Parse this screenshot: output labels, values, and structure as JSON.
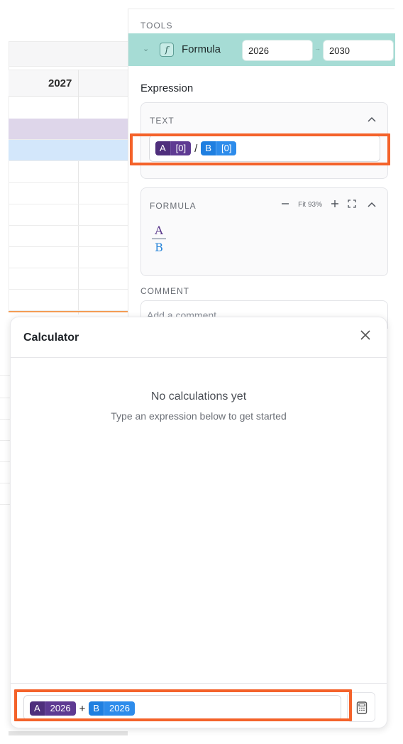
{
  "sheet": {
    "column_year": "2027"
  },
  "tools": {
    "section_title": "TOOLS",
    "formula_row": {
      "name": "Formula",
      "start_year": "2026",
      "end_year": "2030"
    },
    "expression_label": "Expression",
    "text_card": {
      "title": "TEXT",
      "tokens": {
        "a_letter": "A",
        "a_value": "[0]",
        "operator": "/",
        "b_letter": "B",
        "b_value": "[0]"
      }
    },
    "formula_card": {
      "title": "FORMULA",
      "fit_label": "Fit 93%",
      "numerator": "A",
      "denominator": "B"
    },
    "comment": {
      "title": "COMMENT",
      "placeholder": "Add a comment"
    }
  },
  "calculator": {
    "title": "Calculator",
    "empty_title": "No calculations yet",
    "empty_subtitle": "Type an expression below to get started",
    "input_tokens": {
      "a_letter": "A",
      "a_value": "2026",
      "operator": "+",
      "b_letter": "B",
      "b_value": "2026"
    }
  },
  "colors": {
    "accent_teal": "#a6dcd5",
    "token_a": "#5e3a92",
    "token_b": "#2d8ceb",
    "highlight": "#f4622a"
  },
  "icons": [
    "chevron-down-icon",
    "function-icon",
    "arrow-right-icon",
    "chevron-up-icon",
    "minus-icon",
    "plus-icon",
    "expand-icon",
    "close-icon",
    "calculator-icon"
  ]
}
